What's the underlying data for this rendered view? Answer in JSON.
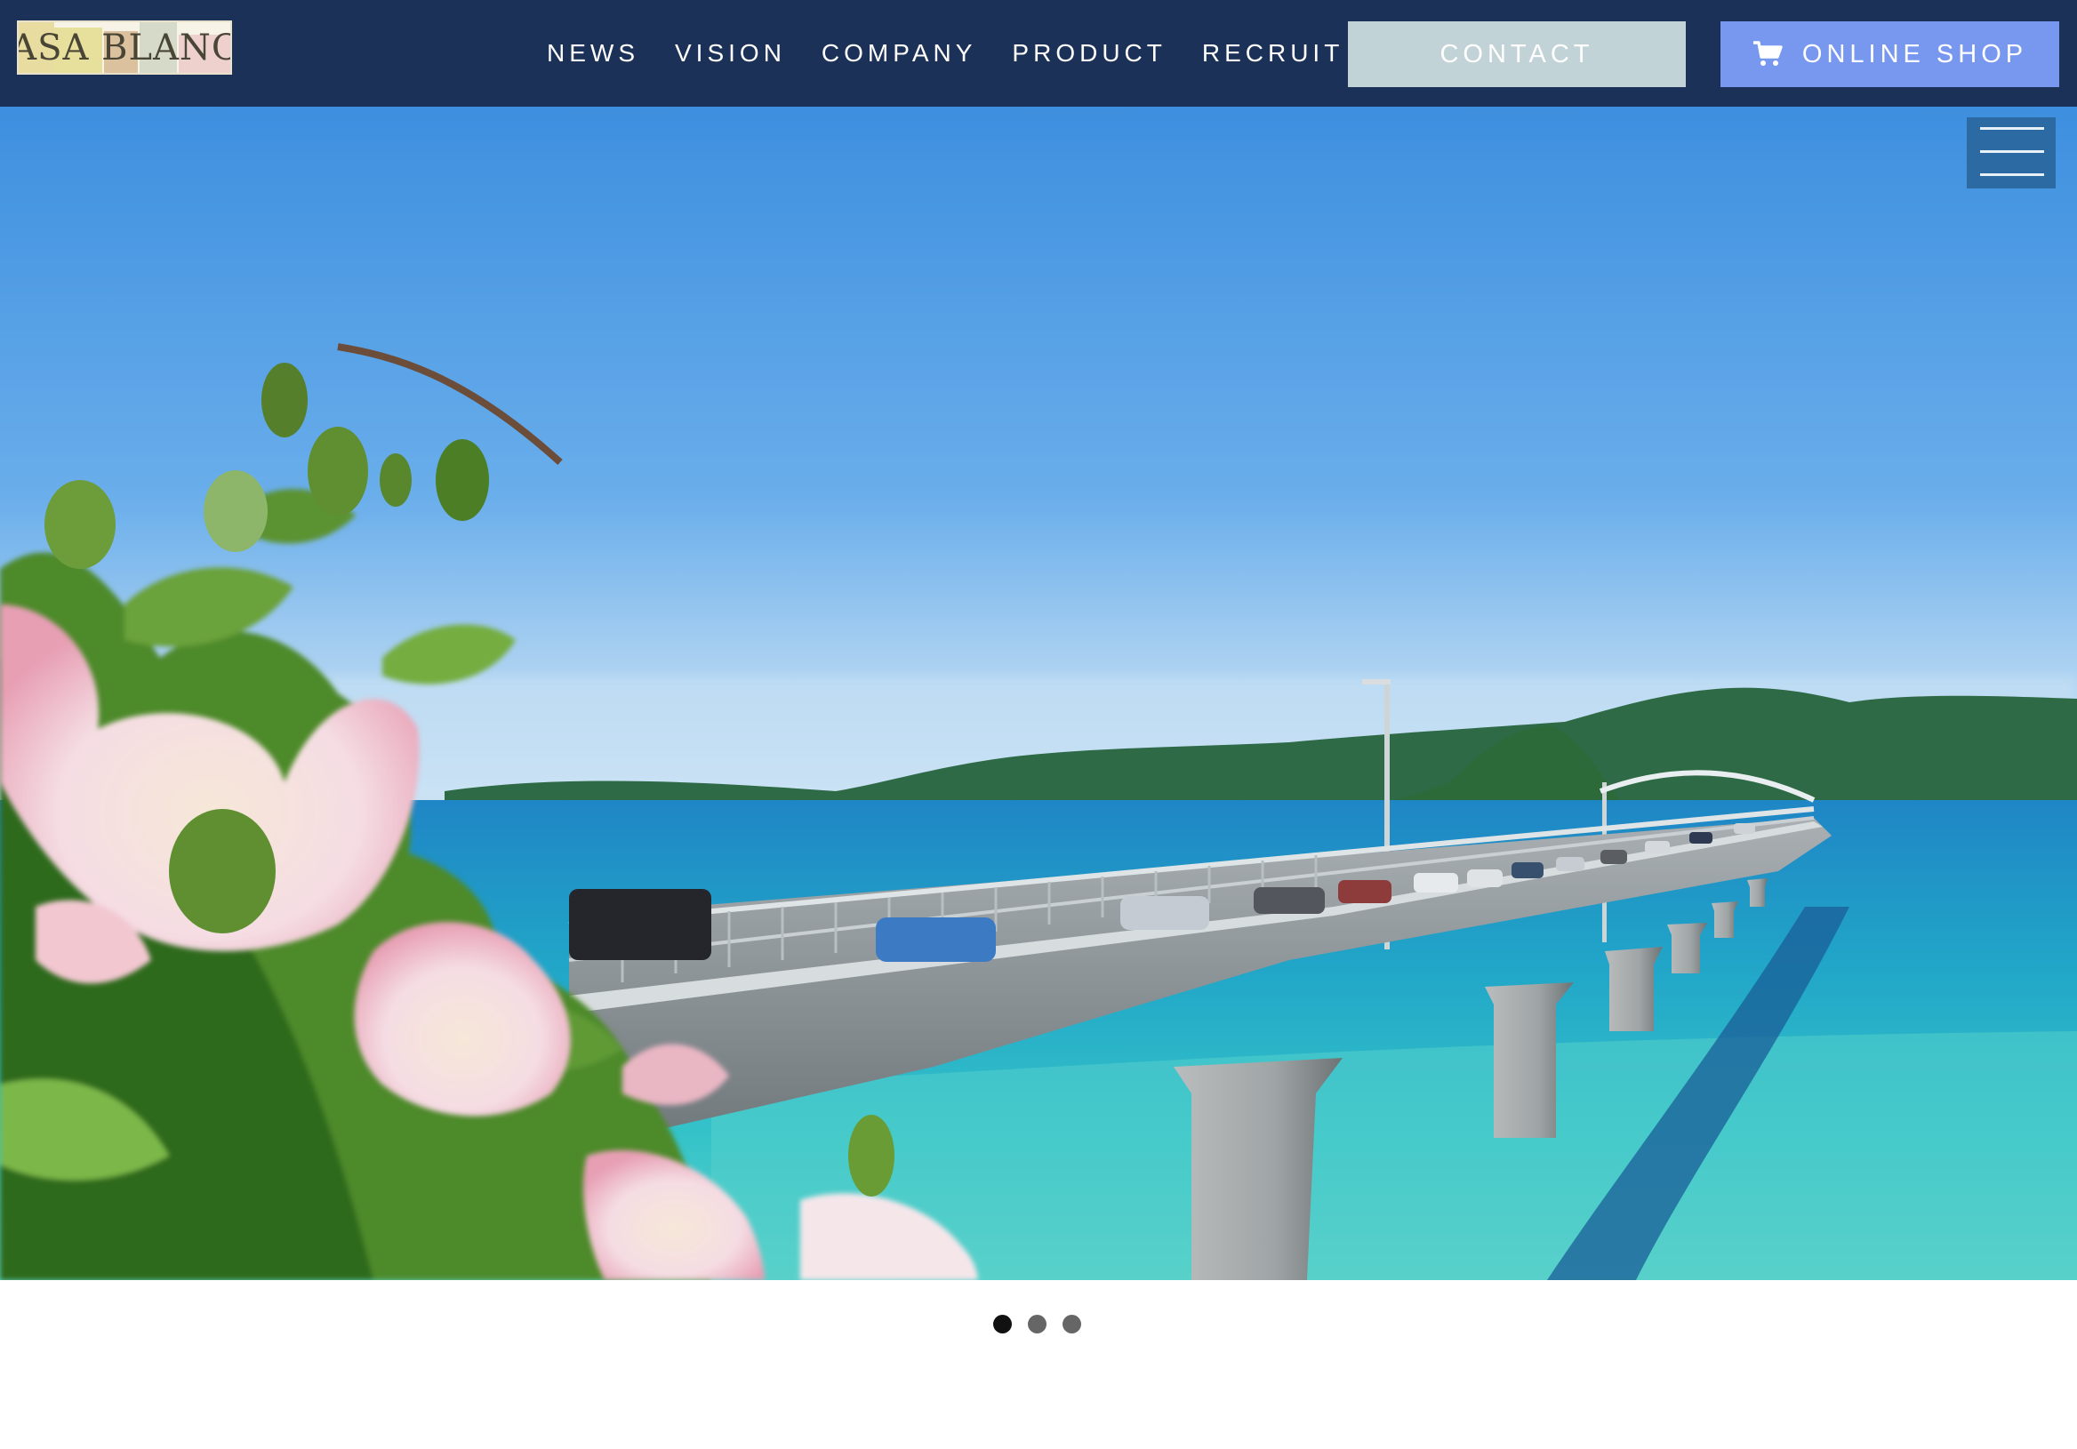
{
  "header": {
    "logo_text": "CASA BLANCA",
    "nav": [
      {
        "label": "NEWS"
      },
      {
        "label": "VISION"
      },
      {
        "label": "COMPANY"
      },
      {
        "label": "PRODUCT"
      },
      {
        "label": "RECRUIT"
      }
    ],
    "contact_label": "CONTACT",
    "shop_label": "ONLINE SHOP",
    "shop_icon": "cart-icon"
  },
  "hero": {
    "menu_icon": "hamburger-menu-icon"
  },
  "carousel": {
    "slide_count": 3,
    "active_index": 0
  },
  "colors": {
    "header_bg": "#1b3158",
    "contact_bg": "#c2d3d7",
    "shop_bg": "#7898ef",
    "menu_bg": "#2b6aa3"
  }
}
